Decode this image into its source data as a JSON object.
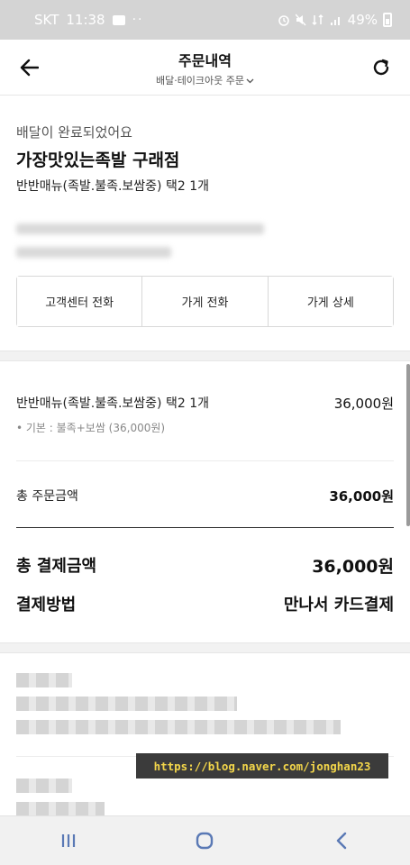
{
  "status_bar": {
    "carrier": "SKT",
    "time": "11:38",
    "dots": "··",
    "battery": "49%"
  },
  "header": {
    "title": "주문내역",
    "subtitle": "배달·테이크아웃 주문"
  },
  "order": {
    "status": "배달이 완료되었어요",
    "store": "가장맛있는족발 구래점",
    "summary": "반반매뉴(족발.불족.보쌈중) 택2 1개"
  },
  "actions": {
    "call_center": "고객센터 전화",
    "call_store": "가게 전화",
    "store_detail": "가게 상세"
  },
  "items": [
    {
      "name": "반반매뉴(족발.불족.보쌈중) 택2 1개",
      "price": "36,000원",
      "option": "• 기본 : 불족+보쌈 (36,000원)"
    }
  ],
  "totals": {
    "order_label": "총 주문금액",
    "order_value": "36,000원",
    "pay_label": "총 결제금액",
    "pay_value": "36,000원",
    "method_label": "결제방법",
    "method_value": "만나서 카드결제"
  },
  "watermark": "https://blog.naver.com/jonghan23"
}
